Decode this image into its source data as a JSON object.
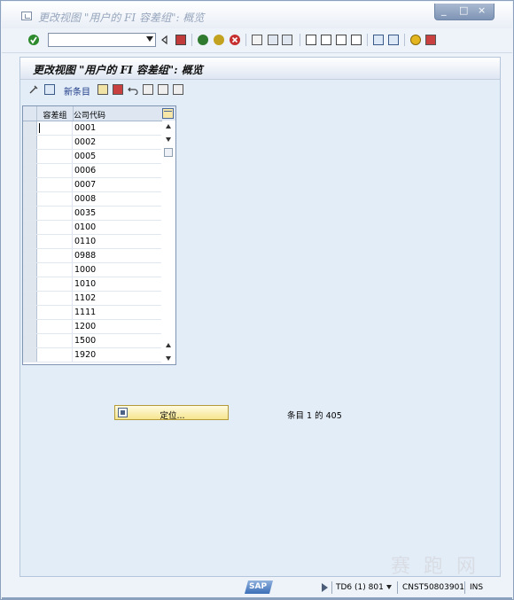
{
  "window": {
    "title": "更改视图 \"用户的 FI 容差组\": 概览",
    "controls": [
      "_",
      "□",
      "×"
    ]
  },
  "toolbar": {
    "command_field_value": "",
    "buttons": [
      "enter-icon",
      "back-icon",
      "save-icon",
      "back-nav-icon",
      "exit-icon",
      "cancel-icon",
      "print-icon",
      "find-icon",
      "find-next-icon",
      "first-page-icon",
      "prev-page-icon",
      "next-page-icon",
      "last-page-icon",
      "new-session-icon",
      "shortcut-icon",
      "help-icon",
      "layout-icon"
    ]
  },
  "screen": {
    "title": "更改视图 \"用户的 FI 容差组\": 概览",
    "app_toolbar": {
      "new_entries_label": "新条目"
    }
  },
  "table": {
    "columns": [
      "容差组",
      "公司代码"
    ],
    "rows": [
      {
        "group": "",
        "company_code": "0001"
      },
      {
        "group": "",
        "company_code": "0002"
      },
      {
        "group": "",
        "company_code": "0005"
      },
      {
        "group": "",
        "company_code": "0006"
      },
      {
        "group": "",
        "company_code": "0007"
      },
      {
        "group": "",
        "company_code": "0008"
      },
      {
        "group": "",
        "company_code": "0035"
      },
      {
        "group": "",
        "company_code": "0100"
      },
      {
        "group": "",
        "company_code": "0110"
      },
      {
        "group": "",
        "company_code": "0988"
      },
      {
        "group": "",
        "company_code": "1000"
      },
      {
        "group": "",
        "company_code": "1010"
      },
      {
        "group": "",
        "company_code": "1102"
      },
      {
        "group": "",
        "company_code": "1111"
      },
      {
        "group": "",
        "company_code": "1200"
      },
      {
        "group": "",
        "company_code": "1500"
      },
      {
        "group": "",
        "company_code": "1920"
      }
    ]
  },
  "position_button": {
    "label": "定位..."
  },
  "entries_info": "条目 1 的 405",
  "status_bar": {
    "sap_logo": "SAP",
    "system": "TD6 (1) 801",
    "server": "CNST50803901",
    "mode": "INS"
  },
  "watermark": "赛 跑 网",
  "colors": {
    "window_bg": "#eef3f9",
    "screen_bg": "#e3edf8",
    "title_text": "#97a6bd",
    "button_yellow": "#f6e58e",
    "new_entries_blue": "#1c3a86"
  }
}
